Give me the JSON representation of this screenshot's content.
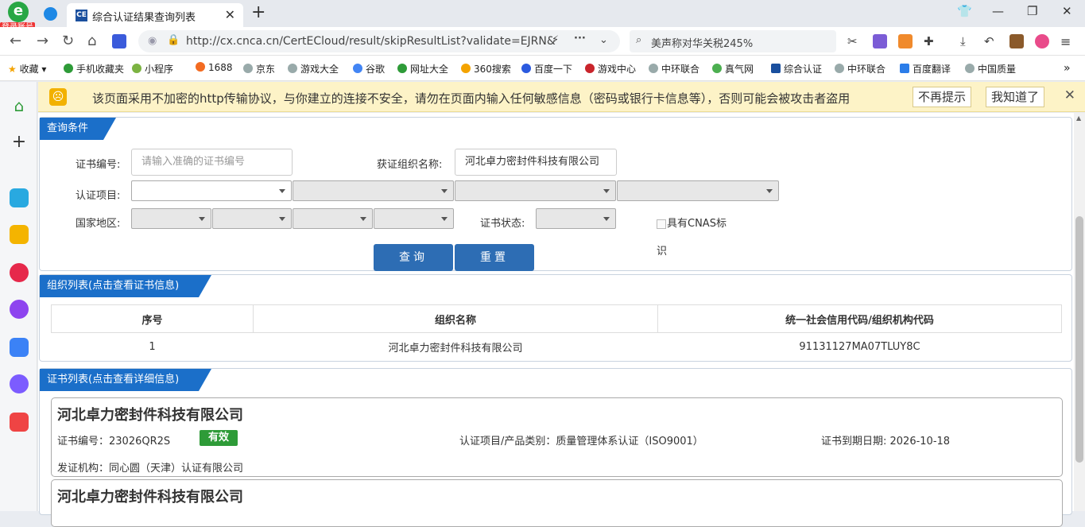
{
  "browser": {
    "login_badge": "登录账号",
    "tab_title": "综合认证结果查询列表",
    "tab_favicon": "CE",
    "url": "http://cx.cnca.cn/CertECloud/result/skipResultList?validate=EJRN&",
    "search_text": "美声称对华关税245%"
  },
  "bookmarks": [
    "收藏",
    "手机收藏夹",
    "小程序",
    "1688",
    "京东",
    "游戏大全",
    "谷歌",
    "网址大全",
    "360搜索",
    "百度一下",
    "游戏中心",
    "中环联合",
    "真气网",
    "综合认证",
    "中环联合",
    "百度翻译",
    "中国质量"
  ],
  "warning": {
    "message": "该页面采用不加密的http传输协议，与你建立的连接不安全，请勿在页面内输入任何敏感信息（密码或银行卡信息等），否则可能会被攻击者盗用",
    "no_remind": "不再提示",
    "got_it": "我知道了"
  },
  "query": {
    "title": "查询条件",
    "cert_no_label": "证书编号:",
    "cert_no_placeholder": "请输入准确的证书编号",
    "org_label": "获证组织名称:",
    "org_value": "河北卓力密封件科技有限公司",
    "project_label": "认证项目:",
    "region_label": "国家地区:",
    "status_label": "证书状态:",
    "cnas_label": "具有CNAS标",
    "cnas_label_2": "识",
    "search_button": "查询",
    "reset_button": "重置"
  },
  "org_list": {
    "title": "组织列表(点击查看证书信息)",
    "headers": [
      "序号",
      "组织名称",
      "统一社会信用代码/组织机构代码"
    ],
    "rows": [
      [
        "1",
        "河北卓力密封件科技有限公司",
        "91131127MA07TLUY8C"
      ]
    ]
  },
  "cert_list": {
    "title": "证书列表(点击查看详细信息)",
    "cards": [
      {
        "name": "河北卓力密封件科技有限公司",
        "cert_no": "证书编号：23026QR2S",
        "status": "有效",
        "project": "认证项目/产品类别：质量管理体系认证（ISO9001）",
        "expiry": "证书到期日期: 2026-10-18",
        "issuer": "发证机构：同心圆（天津）认证有限公司"
      },
      {
        "name": "河北卓力密封件科技有限公司"
      }
    ]
  }
}
